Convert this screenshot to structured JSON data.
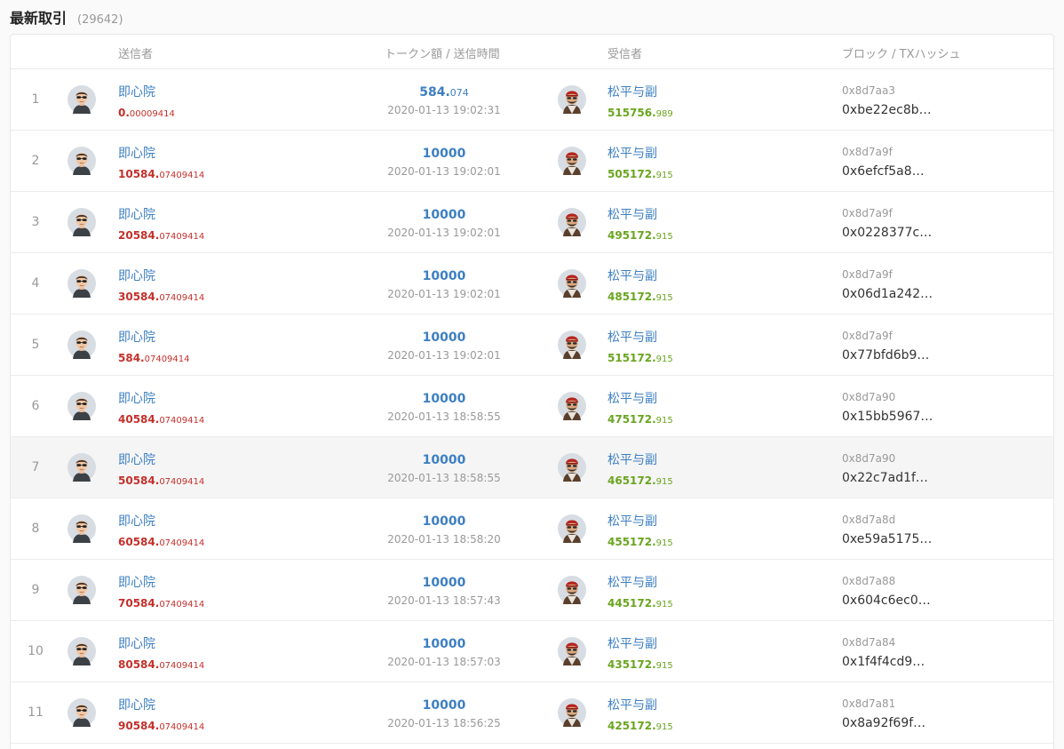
{
  "header": {
    "title": "最新取引",
    "count": "(29642)"
  },
  "columns": {
    "sender": "送信者",
    "amount_time": "トークン額 / 送信時間",
    "receiver": "受信者",
    "block_tx": "ブロック / TXハッシュ"
  },
  "icons": {
    "sender_avatar": "sender-avatar-icon",
    "receiver_avatar": "receiver-avatar-icon"
  },
  "colors": {
    "link_blue": "#3d7fc1",
    "sender_balance_red": "#c4302b",
    "receiver_balance_green": "#6aa51f",
    "highlight_row": "#f5f5f5"
  },
  "rows": [
    {
      "index": "1",
      "sender": "即心院",
      "sender_balance_int": "0.",
      "sender_balance_dec": "00009414",
      "amount_int": "584.",
      "amount_dec": "074",
      "time": "2020-01-13 19:02:31",
      "receiver": "松平与副",
      "receiver_balance_int": "515756.",
      "receiver_balance_dec": "989",
      "block": "0x8d7aa3",
      "tx_hash": "0xbe22ec8b…"
    },
    {
      "index": "2",
      "sender": "即心院",
      "sender_balance_int": "10584.",
      "sender_balance_dec": "07409414",
      "amount_int": "10000",
      "amount_dec": "",
      "time": "2020-01-13 19:02:01",
      "receiver": "松平与副",
      "receiver_balance_int": "505172.",
      "receiver_balance_dec": "915",
      "block": "0x8d7a9f",
      "tx_hash": "0x6efcf5a8…"
    },
    {
      "index": "3",
      "sender": "即心院",
      "sender_balance_int": "20584.",
      "sender_balance_dec": "07409414",
      "amount_int": "10000",
      "amount_dec": "",
      "time": "2020-01-13 19:02:01",
      "receiver": "松平与副",
      "receiver_balance_int": "495172.",
      "receiver_balance_dec": "915",
      "block": "0x8d7a9f",
      "tx_hash": "0x0228377c…"
    },
    {
      "index": "4",
      "sender": "即心院",
      "sender_balance_int": "30584.",
      "sender_balance_dec": "07409414",
      "amount_int": "10000",
      "amount_dec": "",
      "time": "2020-01-13 19:02:01",
      "receiver": "松平与副",
      "receiver_balance_int": "485172.",
      "receiver_balance_dec": "915",
      "block": "0x8d7a9f",
      "tx_hash": "0x06d1a242…"
    },
    {
      "index": "5",
      "sender": "即心院",
      "sender_balance_int": "584.",
      "sender_balance_dec": "07409414",
      "amount_int": "10000",
      "amount_dec": "",
      "time": "2020-01-13 19:02:01",
      "receiver": "松平与副",
      "receiver_balance_int": "515172.",
      "receiver_balance_dec": "915",
      "block": "0x8d7a9f",
      "tx_hash": "0x77bfd6b9…"
    },
    {
      "index": "6",
      "sender": "即心院",
      "sender_balance_int": "40584.",
      "sender_balance_dec": "07409414",
      "amount_int": "10000",
      "amount_dec": "",
      "time": "2020-01-13 18:58:55",
      "receiver": "松平与副",
      "receiver_balance_int": "475172.",
      "receiver_balance_dec": "915",
      "block": "0x8d7a90",
      "tx_hash": "0x15bb5967…"
    },
    {
      "index": "7",
      "sender": "即心院",
      "sender_balance_int": "50584.",
      "sender_balance_dec": "07409414",
      "amount_int": "10000",
      "amount_dec": "",
      "time": "2020-01-13 18:58:55",
      "receiver": "松平与副",
      "receiver_balance_int": "465172.",
      "receiver_balance_dec": "915",
      "block": "0x8d7a90",
      "tx_hash": "0x22c7ad1f…",
      "highlighted": true
    },
    {
      "index": "8",
      "sender": "即心院",
      "sender_balance_int": "60584.",
      "sender_balance_dec": "07409414",
      "amount_int": "10000",
      "amount_dec": "",
      "time": "2020-01-13 18:58:20",
      "receiver": "松平与副",
      "receiver_balance_int": "455172.",
      "receiver_balance_dec": "915",
      "block": "0x8d7a8d",
      "tx_hash": "0xe59a5175…"
    },
    {
      "index": "9",
      "sender": "即心院",
      "sender_balance_int": "70584.",
      "sender_balance_dec": "07409414",
      "amount_int": "10000",
      "amount_dec": "",
      "time": "2020-01-13 18:57:43",
      "receiver": "松平与副",
      "receiver_balance_int": "445172.",
      "receiver_balance_dec": "915",
      "block": "0x8d7a88",
      "tx_hash": "0x604c6ec0…"
    },
    {
      "index": "10",
      "sender": "即心院",
      "sender_balance_int": "80584.",
      "sender_balance_dec": "07409414",
      "amount_int": "10000",
      "amount_dec": "",
      "time": "2020-01-13 18:57:03",
      "receiver": "松平与副",
      "receiver_balance_int": "435172.",
      "receiver_balance_dec": "915",
      "block": "0x8d7a84",
      "tx_hash": "0x1f4f4cd9…"
    },
    {
      "index": "11",
      "sender": "即心院",
      "sender_balance_int": "90584.",
      "sender_balance_dec": "07409414",
      "amount_int": "10000",
      "amount_dec": "",
      "time": "2020-01-13 18:56:25",
      "receiver": "松平与副",
      "receiver_balance_int": "425172.",
      "receiver_balance_dec": "915",
      "block": "0x8d7a81",
      "tx_hash": "0x8a92f69f…"
    }
  ]
}
